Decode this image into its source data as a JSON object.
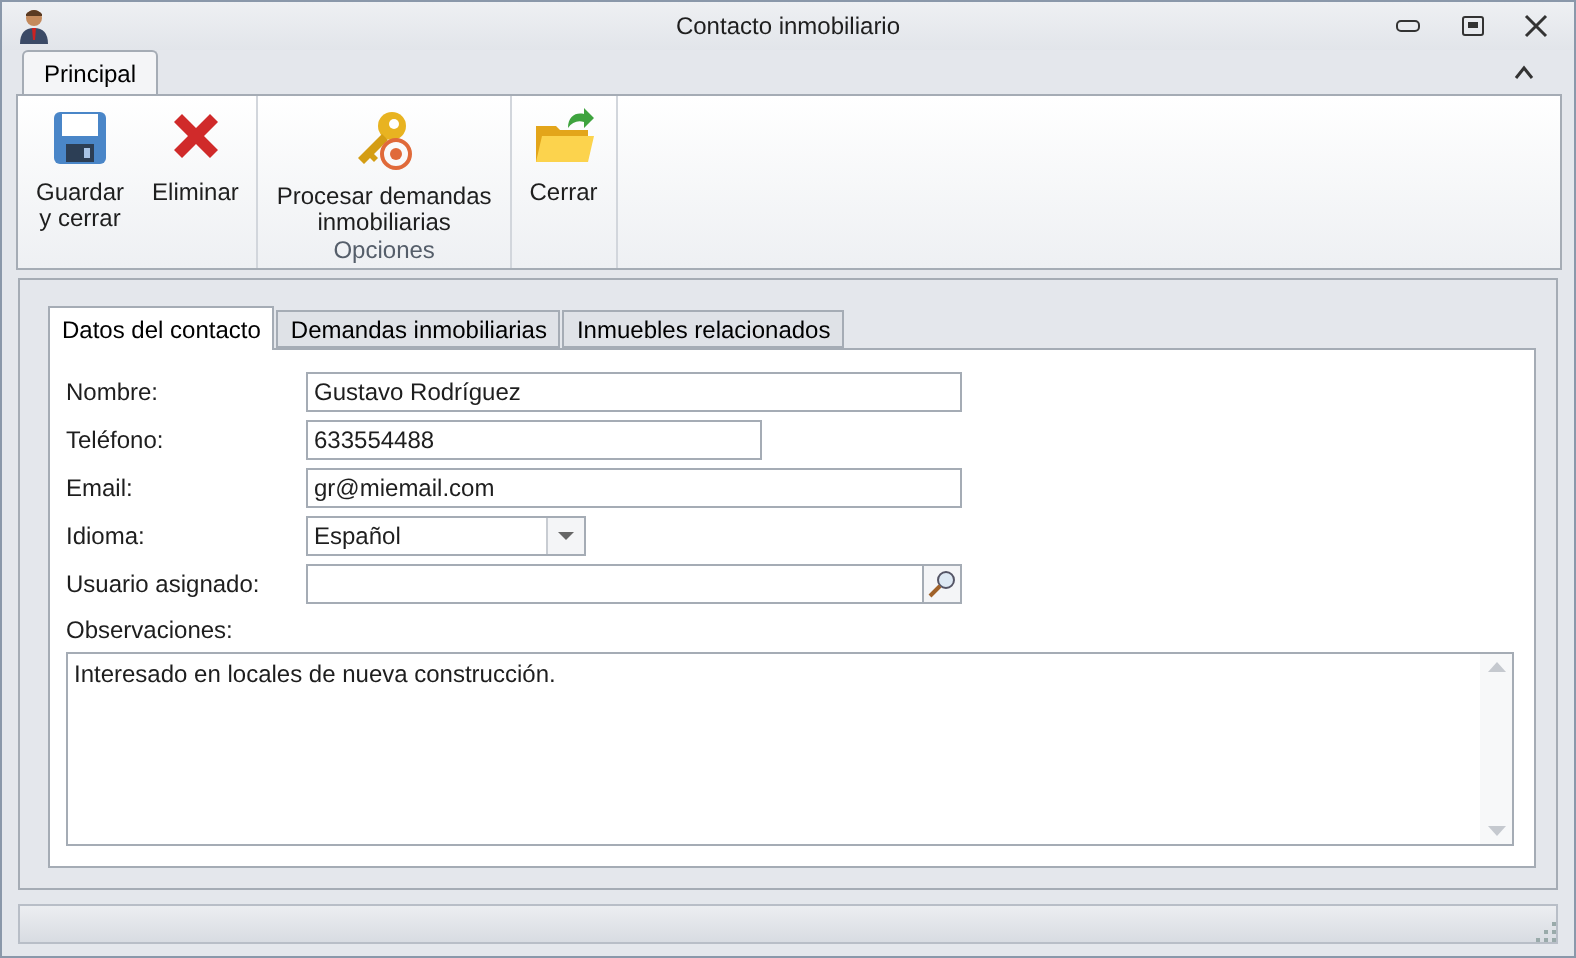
{
  "window": {
    "title": "Contacto inmobiliario"
  },
  "ribbon": {
    "tabs": [
      {
        "label": "Principal",
        "selected": true
      }
    ],
    "groups": [
      {
        "buttons": [
          {
            "label": "Guardar\ny cerrar"
          },
          {
            "label": "Eliminar"
          }
        ]
      },
      {
        "label": "Opciones",
        "buttons": [
          {
            "label": "Procesar demandas\ninmobiliarias"
          }
        ]
      },
      {
        "buttons": [
          {
            "label": "Cerrar"
          }
        ]
      }
    ]
  },
  "tabs": [
    {
      "label": "Datos del contacto",
      "selected": true
    },
    {
      "label": "Demandas inmobiliarias",
      "selected": false
    },
    {
      "label": "Inmuebles relacionados",
      "selected": false
    }
  ],
  "fields": [
    {
      "label": "Nombre:",
      "kind": "text",
      "value": "Gustavo Rodríguez"
    },
    {
      "label": "Teléfono:",
      "kind": "text",
      "value": "633554488"
    },
    {
      "label": "Email:",
      "kind": "text",
      "value": "gr@miemail.com"
    },
    {
      "label": "Idioma:",
      "kind": "combo",
      "value": "Español"
    },
    {
      "label": "Usuario asignado:",
      "kind": "lookup"
    }
  ],
  "notes": {
    "label": "Observaciones:",
    "value": "Interesado en locales de nueva construcción."
  }
}
